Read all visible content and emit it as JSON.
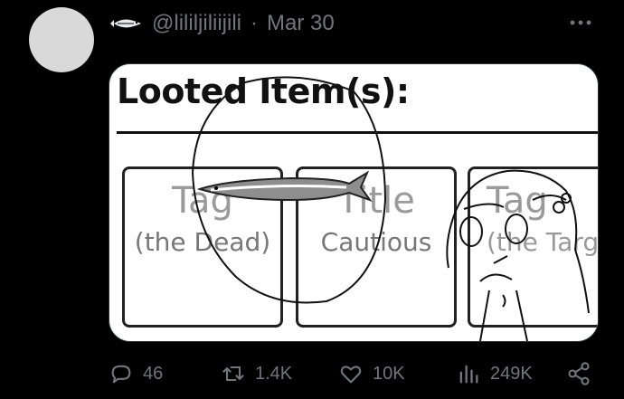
{
  "post": {
    "handle": "@lililjiliijili",
    "separator": "·",
    "date": "Mar 30"
  },
  "media": {
    "title": "Looted Item(s):",
    "cards": [
      {
        "line1": "Tag",
        "line2": "(the Dead)"
      },
      {
        "line1": "Title",
        "line2": "Cautious"
      },
      {
        "line1": "Tag",
        "line2": "(the Targe"
      }
    ]
  },
  "actions": {
    "replies": "46",
    "reposts": "1.4K",
    "likes": "10K",
    "views": "249K"
  },
  "icons": [
    "fish-icon",
    "more-icon",
    "reply-icon",
    "repost-icon",
    "like-icon",
    "views-icon",
    "share-icon"
  ],
  "colors": {
    "background": "#000000",
    "muted": "#71767b",
    "avatar": "#d9d9d9"
  }
}
